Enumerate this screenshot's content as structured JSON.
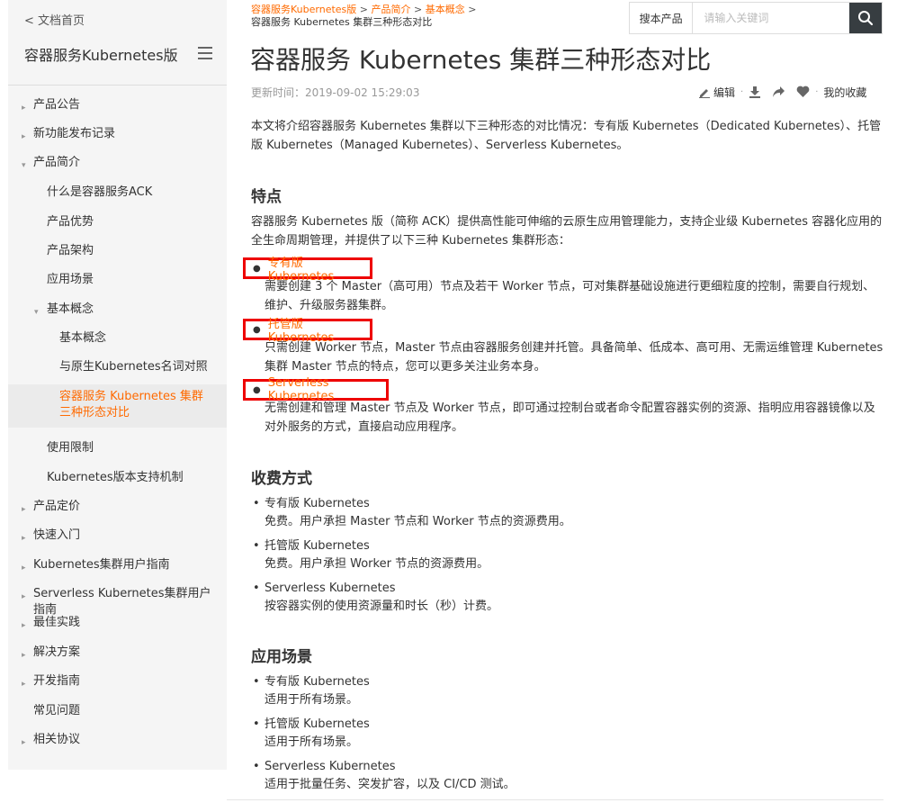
{
  "sidebar": {
    "back_label": "< 文档首页",
    "title": "容器服务Kubernetes版",
    "items": [
      {
        "label": "产品公告",
        "arrow": "▸"
      },
      {
        "label": "新功能发布记录",
        "arrow": "▸"
      },
      {
        "label": "产品简介",
        "arrow": "▾"
      },
      {
        "label": "什么是容器服务ACK",
        "arrow": ""
      },
      {
        "label": "产品优势",
        "arrow": ""
      },
      {
        "label": "产品架构",
        "arrow": ""
      },
      {
        "label": "应用场景",
        "arrow": ""
      },
      {
        "label": "基本概念",
        "arrow": "▾"
      },
      {
        "label": "基本概念",
        "arrow": ""
      },
      {
        "label": "与原生Kubernetes名词对照",
        "arrow": ""
      },
      {
        "label": "容器服务 Kubernetes 集群三种形态对比",
        "arrow": ""
      },
      {
        "label": "使用限制",
        "arrow": ""
      },
      {
        "label": "Kubernetes版本支持机制",
        "arrow": ""
      },
      {
        "label": "产品定价",
        "arrow": "▸"
      },
      {
        "label": "快速入门",
        "arrow": "▸"
      },
      {
        "label": "Kubernetes集群用户指南",
        "arrow": "▸"
      },
      {
        "label": "Serverless Kubernetes集群用户指南",
        "arrow": "▸"
      },
      {
        "label": "最佳实践",
        "arrow": "▸"
      },
      {
        "label": "解决方案",
        "arrow": "▸"
      },
      {
        "label": "开发指南",
        "arrow": "▸"
      },
      {
        "label": "常见问题",
        "arrow": ""
      },
      {
        "label": "相关协议",
        "arrow": "▸"
      }
    ]
  },
  "breadcrumb": {
    "items": [
      "容器服务Kubernetes版",
      "产品简介",
      "基本概念"
    ],
    "separator": ">",
    "current": "容器服务 Kubernetes 集群三种形态对比"
  },
  "search": {
    "scope_label": "搜本产品",
    "placeholder": "请输入关键词"
  },
  "article": {
    "title": "容器服务 Kubernetes 集群三种形态对比",
    "update_time": "更新时间：2019-09-02 15:29:03",
    "toolbar": {
      "edit_label": "编辑",
      "favorite_label": "我的收藏"
    },
    "intro": "本文将介绍容器服务 Kubernetes 集群以下三种形态的对比情况：专有版 Kubernetes（Dedicated Kubernetes）、托管版 Kubernetes（Managed Kubernetes）、Serverless Kubernetes。",
    "features": {
      "heading": "特点",
      "intro": "容器服务 Kubernetes 版（简称 ACK）提供高性能可伸缩的云原生应用管理能力，支持企业级 Kubernetes 容器化应用的全生命周期管理，并提供了以下三种 Kubernetes 集群形态：",
      "items": [
        {
          "name": "专有版 Kubernetes",
          "desc": "需要创建 3 个 Master（高可用）节点及若干 Worker 节点，可对集群基础设施进行更细粒度的控制，需要自行规划、维护、升级服务器集群。"
        },
        {
          "name": "托管版 Kubernetes",
          "desc": "只需创建 Worker 节点，Master 节点由容器服务创建并托管。具备简单、低成本、高可用、无需运维管理 Kubernetes 集群 Master 节点的特点，您可以更多关注业务本身。"
        },
        {
          "name": "Serverless Kubernetes",
          "desc": "无需创建和管理 Master 节点及 Worker 节点，即可通过控制台或者命令配置容器实例的资源、指明应用容器镜像以及对外服务的方式，直接启动应用程序。"
        }
      ]
    },
    "billing": {
      "heading": "收费方式",
      "items": [
        {
          "name": "专有版 Kubernetes",
          "desc": "免费。用户承担 Master 节点和 Worker 节点的资源费用。"
        },
        {
          "name": "托管版 Kubernetes",
          "desc": "免费。用户承担 Worker 节点的资源费用。"
        },
        {
          "name": "Serverless Kubernetes",
          "desc": "按容器实例的使用资源量和时长（秒）计费。"
        }
      ]
    },
    "scenarios": {
      "heading": "应用场景",
      "items": [
        {
          "name": "专有版 Kubernetes",
          "desc": "适用于所有场景。"
        },
        {
          "name": "托管版 Kubernetes",
          "desc": "适用于所有场景。"
        },
        {
          "name": "Serverless Kubernetes",
          "desc": "适用于批量任务、突发扩容，以及 CI/CD 测试。"
        }
      ]
    }
  },
  "colors": {
    "accent": "#ff6a00",
    "highlight_border": "#ee0000",
    "search_button": "#373d41"
  }
}
